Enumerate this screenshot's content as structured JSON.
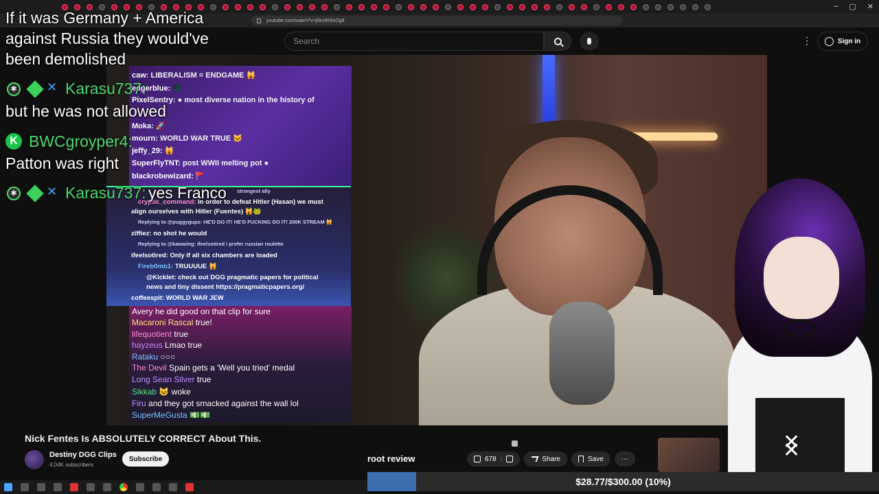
{
  "browser": {
    "url": "youtube.com/watch?v=j0kz8K6xOg8"
  },
  "youtube": {
    "search_placeholder": "Search",
    "sign_in_label": "Sign in",
    "video_title": "Nick Fentes Is ABSOLUTELY CORRECT About This.",
    "channel_name": "Destiny DGG Clips",
    "channel_subs": "4.04K subscribers",
    "subscribe_label": "Subscribe",
    "likes": "678",
    "share_label": "Share",
    "save_label": "Save",
    "more_label": "⋯"
  },
  "overlay": {
    "root_review": "root review",
    "goal_text": "$28.77/$300.00 (10%)",
    "goal_progress": 0.0959
  },
  "big_chat": {
    "line1": "If it was Germany + America",
    "line2": "against Russia they would've",
    "line3": "been demolished",
    "user1": "Karasu737:",
    "msg1": "but he was not allowed",
    "user2": "BWCgroyper4:",
    "msg2": "Patton was right",
    "user3": "Karasu737:",
    "msg3": "yes Franco"
  },
  "chatA": [
    {
      "user": "caw:",
      "text": "LIBERALISM = ENDGAME 🙀"
    },
    {
      "user": "edgerblue:",
      "text": "🌑"
    },
    {
      "user": "PixelSentry:",
      "text": "● most diverse nation in the history of"
    },
    {
      "user": "Moka:",
      "text": "🚀"
    },
    {
      "user": "mourn:",
      "text": "WORLD WAR TRUE 🐱"
    },
    {
      "user": "jeffy_29:",
      "text": "🙀"
    },
    {
      "user": "SuperFlyTNT:",
      "text": "post WWII melting pot ●"
    },
    {
      "user": "blackrobewizard:",
      "text": "🚩"
    }
  ],
  "chatB": [
    {
      "user": "cryptic_command:",
      "text": "in order to defeat Hitler (Hasan) we must"
    },
    {
      "user": "",
      "text": "align ourselves with Hitler (Fuentes) 🙀🐸"
    },
    {
      "user": "",
      "text": "Replying to @puggygups: HE'D DO IT! HE'D FUCKING DO IT! 200K STREAM 🙀"
    },
    {
      "user": "ziffiez:",
      "text": "no shot he would"
    },
    {
      "user": "",
      "text": "Replying to @kawaiieg: ifeelsotired i prefer russian roulette"
    },
    {
      "user": "ifeelsotired:",
      "text": "Only if all six chambers are loaded"
    },
    {
      "user": "Fireb0mb1:",
      "text": "TRUUUUE 🙀"
    },
    {
      "user": "@Kicklet:",
      "text": "check out DGG pragmatic papers for political"
    },
    {
      "user": "",
      "text": "news and tiny dissent https://pragmaticpapers.org/"
    },
    {
      "user": "coffeespit:",
      "text": "WORLD WAR JEW"
    }
  ],
  "chatB_header": "strongest ally",
  "chatC": [
    {
      "user": "Avery",
      "text": "he did good on that clip for sure"
    },
    {
      "user": "Macaroni Rascal",
      "text": "true!"
    },
    {
      "user": "lifequotient",
      "text": "true"
    },
    {
      "user": "hayzeus",
      "text": "Lmao true"
    },
    {
      "user": "Rataku",
      "text": "○○○"
    },
    {
      "user": "The Devil",
      "text": "Spain gets a 'Well you tried' medal"
    },
    {
      "user": "Long Sean Silver",
      "text": "true"
    },
    {
      "user": "Sikkab",
      "text": "😺 woke"
    },
    {
      "user": "Firu",
      "text": "and they got smacked against the wall lol"
    },
    {
      "user": "SuperMeGusta",
      "text": "💵💵"
    }
  ]
}
